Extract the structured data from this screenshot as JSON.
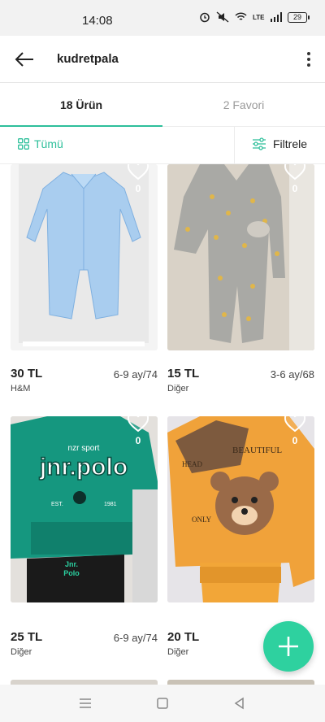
{
  "status_bar": {
    "time": "14:08",
    "network": "LTE",
    "battery": "29"
  },
  "app_bar": {
    "title": "kudretpala"
  },
  "tabs": [
    {
      "label": "18 Ürün",
      "active": true
    },
    {
      "label": "2 Favori",
      "active": false
    }
  ],
  "filters": {
    "all_label": "Tümü",
    "filter_label": "Filtrele"
  },
  "colors": {
    "accent": "#2dbf9a",
    "fab": "#2ed19f"
  },
  "products": [
    {
      "price": "30 TL",
      "size": "6-9 ay/74",
      "brand": "H&M",
      "favorites": "0",
      "image": "blue striped baby sleepsuit"
    },
    {
      "price": "15 TL",
      "size": "3-6 ay/68",
      "brand": "Diğer",
      "favorites": "0",
      "image": "grey hooded baby romper with yellow stars"
    },
    {
      "price": "25 TL",
      "size": "6-9 ay/74",
      "brand": "Diğer",
      "favorites": "0",
      "image": "green jnr.polo sweatshirt set"
    },
    {
      "price": "20 TL",
      "size": "",
      "brand": "Diğer",
      "favorites": "0",
      "image": "orange teddy bear sweatshirt set"
    }
  ],
  "icons": [
    "back-arrow-icon",
    "more-vert-icon",
    "grid-icon",
    "filter-sliders-icon",
    "heart-icon",
    "plus-icon",
    "menu-icon",
    "home-square-icon",
    "back-triangle-icon"
  ]
}
